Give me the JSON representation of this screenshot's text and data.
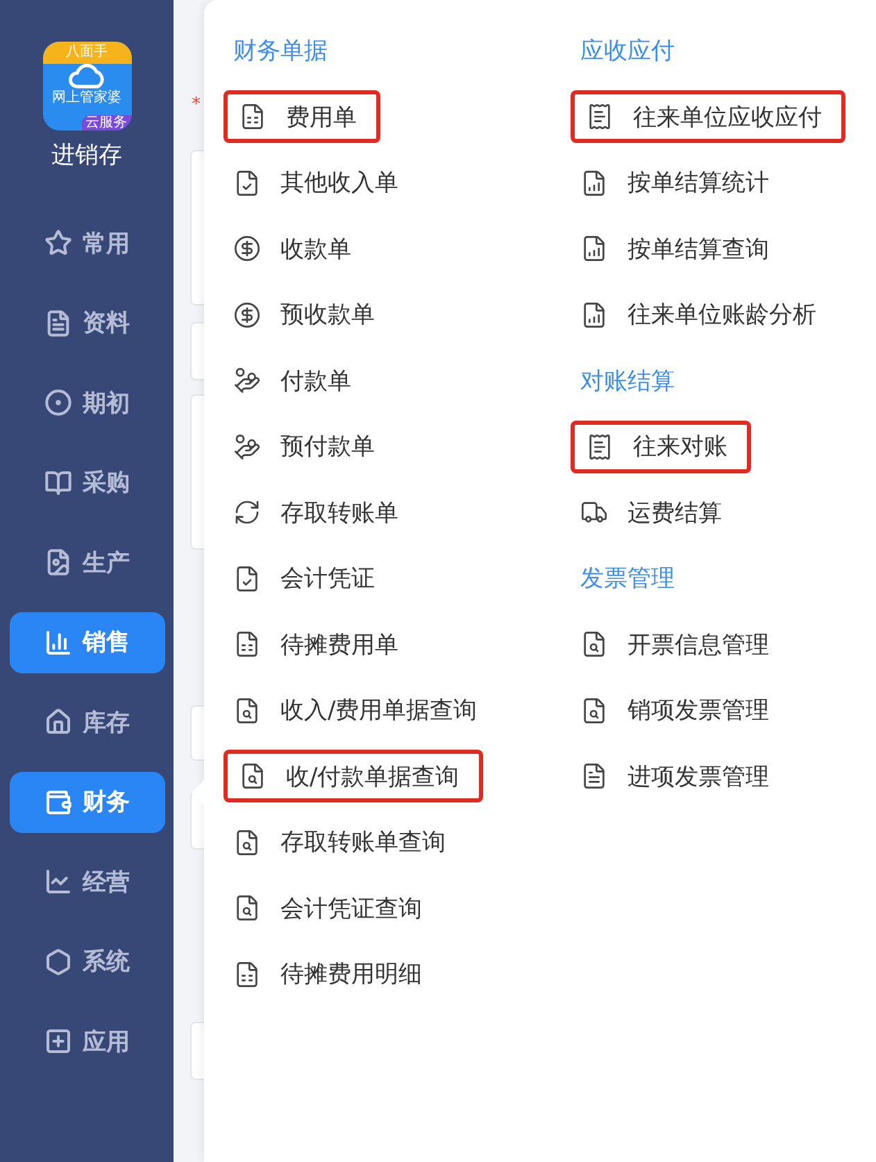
{
  "logo": {
    "top_band": "八面手",
    "caption": "网上管家婆",
    "ribbon": "云服务",
    "app_name": "进销存"
  },
  "sidebar": {
    "items": [
      {
        "label": "常用",
        "selected": false
      },
      {
        "label": "资料",
        "selected": false
      },
      {
        "label": "期初",
        "selected": false
      },
      {
        "label": "采购",
        "selected": false
      },
      {
        "label": "生产",
        "selected": false
      },
      {
        "label": "销售",
        "selected": true
      },
      {
        "label": "库存",
        "selected": false
      },
      {
        "label": "财务",
        "selected": true
      },
      {
        "label": "经营",
        "selected": false
      },
      {
        "label": "系统",
        "selected": false
      },
      {
        "label": "应用",
        "selected": false
      }
    ]
  },
  "background_form": {
    "required_mark": "*"
  },
  "menu": {
    "columns": [
      {
        "sections": [
          {
            "title": "财务单据",
            "items": [
              {
                "label": "费用单",
                "highlighted": true
              },
              {
                "label": "其他收入单",
                "highlighted": false
              },
              {
                "label": "收款单",
                "highlighted": false
              },
              {
                "label": "预收款单",
                "highlighted": false
              },
              {
                "label": "付款单",
                "highlighted": false
              },
              {
                "label": "预付款单",
                "highlighted": false
              },
              {
                "label": "存取转账单",
                "highlighted": false
              },
              {
                "label": "会计凭证",
                "highlighted": false
              },
              {
                "label": "待摊费用单",
                "highlighted": false
              },
              {
                "label": "收入/费用单据查询",
                "highlighted": false
              },
              {
                "label": "收/付款单据查询",
                "highlighted": true
              },
              {
                "label": "存取转账单查询",
                "highlighted": false
              },
              {
                "label": "会计凭证查询",
                "highlighted": false
              },
              {
                "label": "待摊费用明细",
                "highlighted": false
              }
            ]
          }
        ]
      },
      {
        "sections": [
          {
            "title": "应收应付",
            "items": [
              {
                "label": "往来单位应收应付",
                "highlighted": true
              },
              {
                "label": "按单结算统计",
                "highlighted": false
              },
              {
                "label": "按单结算查询",
                "highlighted": false
              },
              {
                "label": "往来单位账龄分析",
                "highlighted": false
              }
            ]
          },
          {
            "title": "对账结算",
            "items": [
              {
                "label": "往来对账",
                "highlighted": true
              },
              {
                "label": "运费结算",
                "highlighted": false
              }
            ]
          },
          {
            "title": "发票管理",
            "items": [
              {
                "label": "开票信息管理",
                "highlighted": false
              },
              {
                "label": "销项发票管理",
                "highlighted": false
              },
              {
                "label": "进项发票管理",
                "highlighted": false
              }
            ]
          }
        ]
      }
    ]
  }
}
